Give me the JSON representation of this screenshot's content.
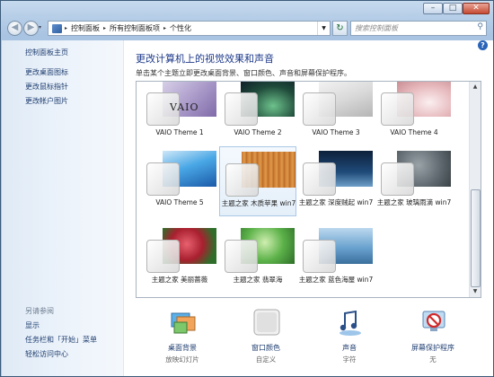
{
  "window": {
    "minimize_glyph": "–",
    "maximize_glyph": "□",
    "close_glyph": "✕"
  },
  "nav": {
    "back_glyph": "◀",
    "forward_glyph": "▶",
    "recent_glyph": "▾",
    "breadcrumb_root_glyph": "▸",
    "breadcrumbs": [
      "控制面板",
      "所有控制面板项",
      "个性化"
    ],
    "separator": "▸",
    "refresh_glyph": "↻",
    "search_placeholder": "搜索控制面板",
    "search_icon": "search-icon"
  },
  "sidebar": {
    "home_link": "控制面板主页",
    "links": [
      "更改桌面图标",
      "更改鼠标指针",
      "更改帐户图片"
    ],
    "see_also_heading": "另请参阅",
    "see_also": [
      "显示",
      "任务栏和「开始」菜单",
      "轻松访问中心"
    ]
  },
  "main": {
    "help_glyph": "?",
    "title": "更改计算机上的视觉效果和声音",
    "subtitle": "单击某个主题立即更改桌面背景、窗口颜色、声音和屏幕保护程序。",
    "themes": [
      {
        "name": "VAIO Theme 1",
        "logo": "VAIO"
      },
      {
        "name": "VAIO Theme 2"
      },
      {
        "name": "VAIO Theme 3"
      },
      {
        "name": "VAIO Theme 4"
      },
      {
        "name": "VAIO Theme 5"
      },
      {
        "name": "主题之家 木质苹果 win7",
        "selected": true
      },
      {
        "name": "主题之家 深度贼起 win7"
      },
      {
        "name": "主题之家 玻璃雨滴 win7"
      },
      {
        "name": "主题之家 美丽蔷薇"
      },
      {
        "name": "主题之家 翡翠海"
      },
      {
        "name": "主题之家 蓝色海屋 win7"
      }
    ],
    "bottom": [
      {
        "title": "桌面背景",
        "subtitle": "放映幻灯片",
        "icon": "desktop-background-icon"
      },
      {
        "title": "窗口颜色",
        "subtitle": "自定义",
        "icon": "window-color-icon"
      },
      {
        "title": "声音",
        "subtitle": "字符",
        "icon": "sound-icon"
      },
      {
        "title": "屏幕保护程序",
        "subtitle": "无",
        "icon": "screensaver-icon"
      }
    ]
  }
}
